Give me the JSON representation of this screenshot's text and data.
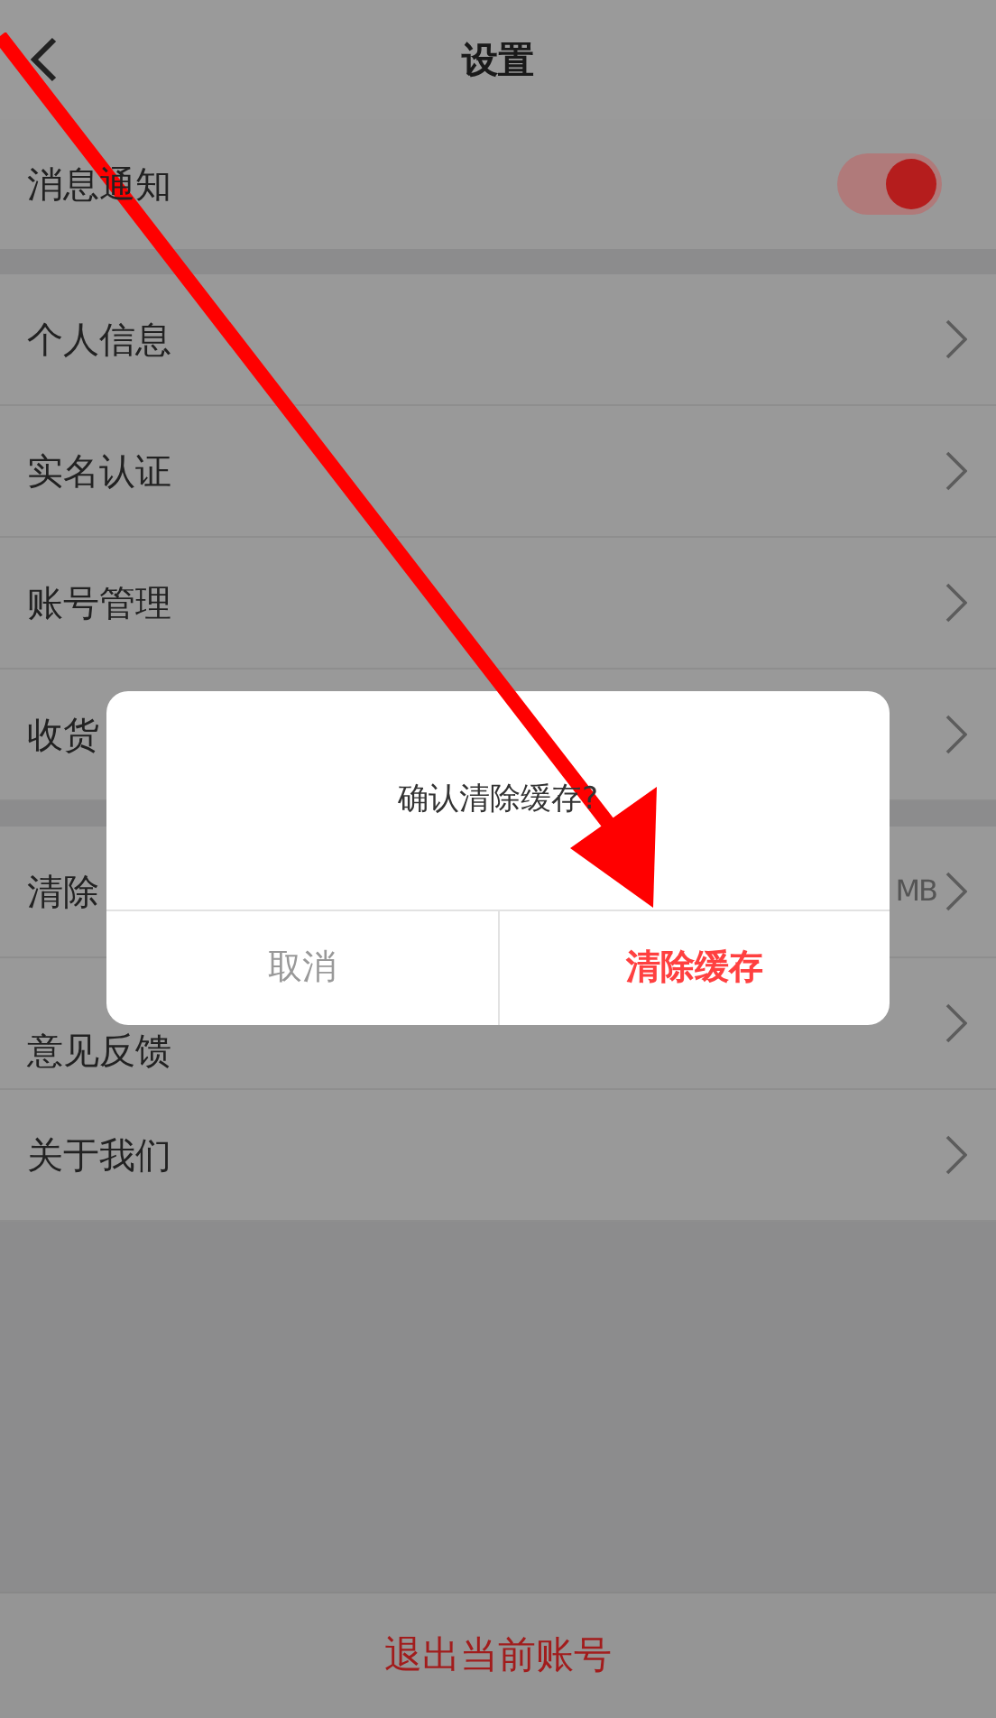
{
  "header": {
    "title": "设置"
  },
  "notification": {
    "label": "消息通知",
    "on": true
  },
  "groups": [
    {
      "items": [
        {
          "label": "个人信息"
        },
        {
          "label": "实名认证"
        },
        {
          "label": "账号管理"
        },
        {
          "label": "收货"
        }
      ]
    },
    {
      "items": [
        {
          "label": "清除",
          "value": "MB"
        },
        {
          "label": "意见反馈"
        },
        {
          "label": "关于我们"
        }
      ]
    }
  ],
  "dialog": {
    "message": "确认清除缓存?",
    "buttons": [
      {
        "label": "取消",
        "kind": "cancel"
      },
      {
        "label": "清除缓存",
        "kind": "confirm"
      }
    ]
  },
  "logout": {
    "label": "退出当前账号"
  }
}
